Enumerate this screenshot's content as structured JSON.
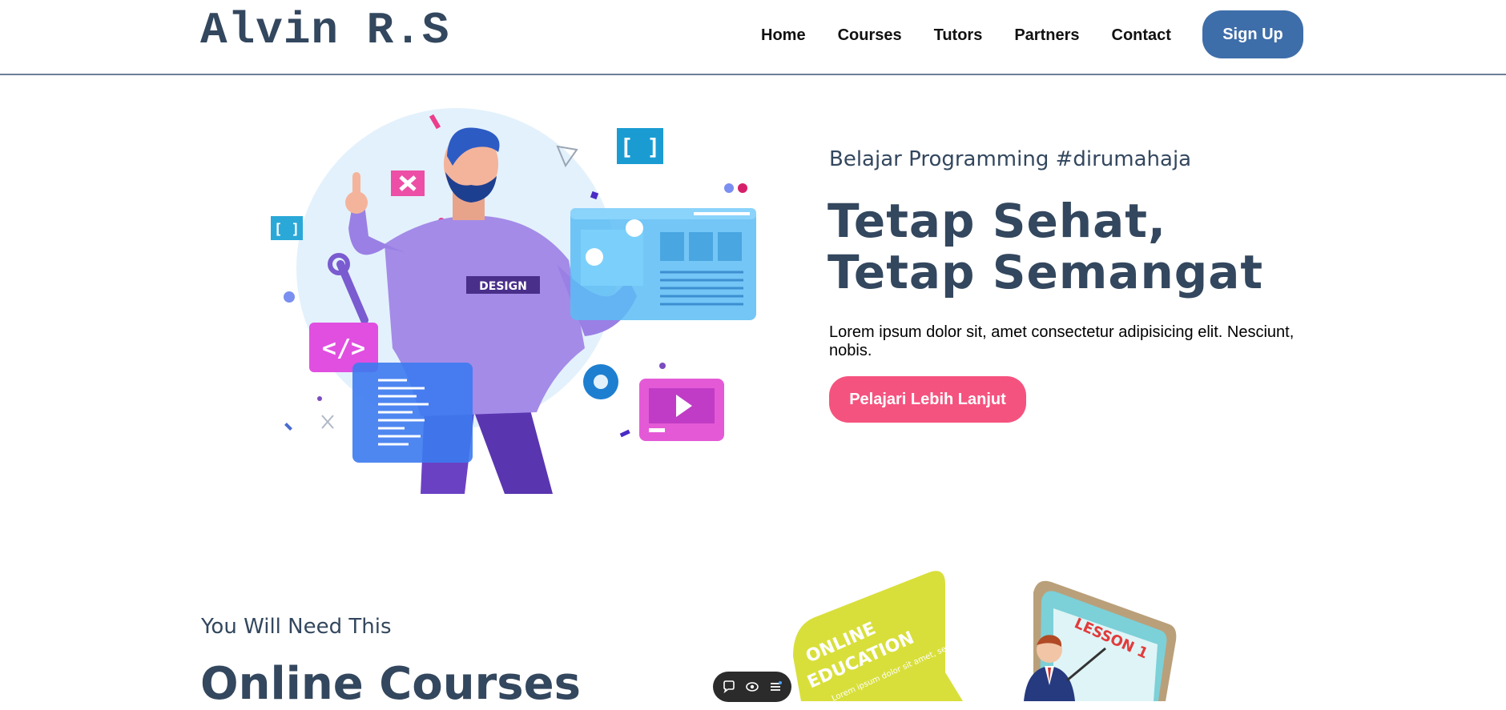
{
  "brand": {
    "logo": "Alvin R.S"
  },
  "nav": {
    "links": [
      "Home",
      "Courses",
      "Tutors",
      "Partners",
      "Contact"
    ],
    "signup_label": "Sign Up"
  },
  "hero": {
    "subtitle": "Belajar Programming #dirumahaja",
    "title": "Tetap Sehat, Tetap Semangat",
    "description": "Lorem ipsum dolor sit, amet consectetur adipisicing elit. Nesciunt, nobis.",
    "cta_label": "Pelajari Lebih Lanjut",
    "illustration": {
      "badge_text": "DESIGN",
      "icons": [
        "close-icon",
        "code-icon",
        "play-icon",
        "gear-icon",
        "wrench-icon",
        "brackets-icon"
      ]
    }
  },
  "section2": {
    "subtitle": "You Will Need This",
    "title": "Online Courses",
    "illustration": {
      "bubble_heading_1": "ONLINE",
      "bubble_heading_2": "EDUCATION",
      "bubble_body": "Lorem ipsum dolor sit amet, sed adipiscing elit, sed eiusmod tempor incididunt ut",
      "tablet_text": "LESSON 1"
    }
  },
  "toolbar": {
    "icons": [
      "comment-icon",
      "eye-icon",
      "menu-icon"
    ]
  },
  "colors": {
    "heading": "#33475e",
    "signup_bg": "#3e6ea9",
    "cta_bg": "#f5537f",
    "nav_border": "#6b7f99"
  }
}
